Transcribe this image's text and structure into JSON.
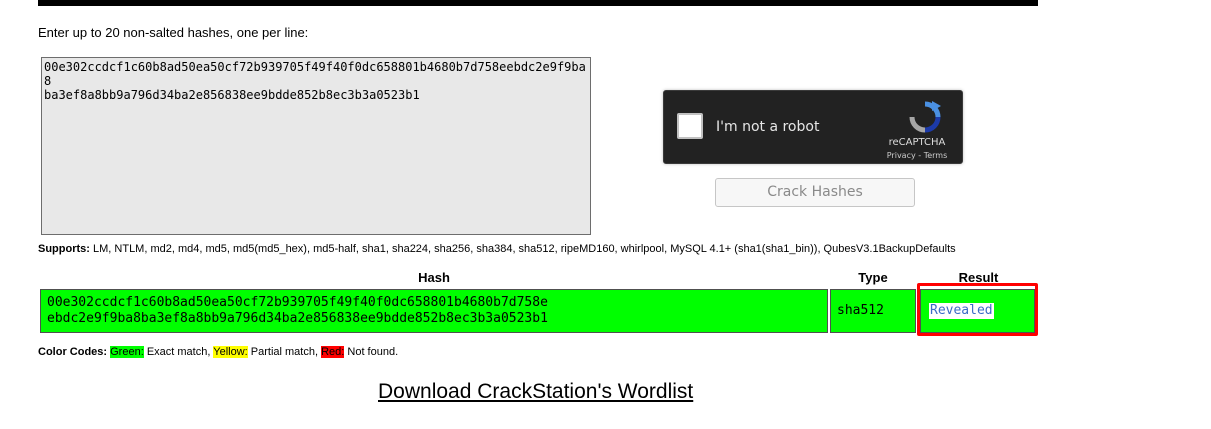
{
  "instruction": "Enter up to 20 non-salted hashes, one per line:",
  "input": {
    "line1": "00e302ccdcf1c60b8ad50ea50cf72b939705f49f40f0dc658801b4680b7d758eebdc2e9f9ba8",
    "line2": "ba3ef8a8bb9a796d34ba2e856838ee9bdde852b8ec3b3a0523b1"
  },
  "captcha": {
    "label": "I'm not a robot",
    "brand": "reCAPTCHA",
    "links": "Privacy - Terms"
  },
  "crack_button": "Crack Hashes",
  "supports": {
    "label": "Supports:",
    "list": " LM, NTLM, md2, md4, md5, md5(md5_hex), md5-half, sha1, sha224, sha256, sha384, sha512, ripeMD160, whirlpool, MySQL 4.1+ (sha1(sha1_bin)), QubesV3.1BackupDefaults"
  },
  "table": {
    "headers": {
      "hash": "Hash",
      "type": "Type",
      "result": "Result"
    },
    "row": {
      "hash_line1": "00e302ccdcf1c60b8ad50ea50cf72b939705f49f40f0dc658801b4680b7d758e",
      "hash_line2": "ebdc2e9f9ba8ba3ef8a8bb9a796d34ba2e856838ee9bdde852b8ec3b3a0523b1",
      "type": "sha512",
      "result": "Revealed",
      "status_color": "#00ff00"
    }
  },
  "legend": {
    "label": "Color Codes:",
    "green": "Green:",
    "green_desc": " Exact match, ",
    "yellow": "Yellow:",
    "yellow_desc": " Partial match, ",
    "red": "Red:",
    "red_desc": " Not found."
  },
  "download_link": "Download CrackStation's Wordlist",
  "colors": {
    "match": "#00ff00",
    "partial": "#ffff00",
    "notfound": "#ff0000",
    "highlight": "#ff0000"
  }
}
